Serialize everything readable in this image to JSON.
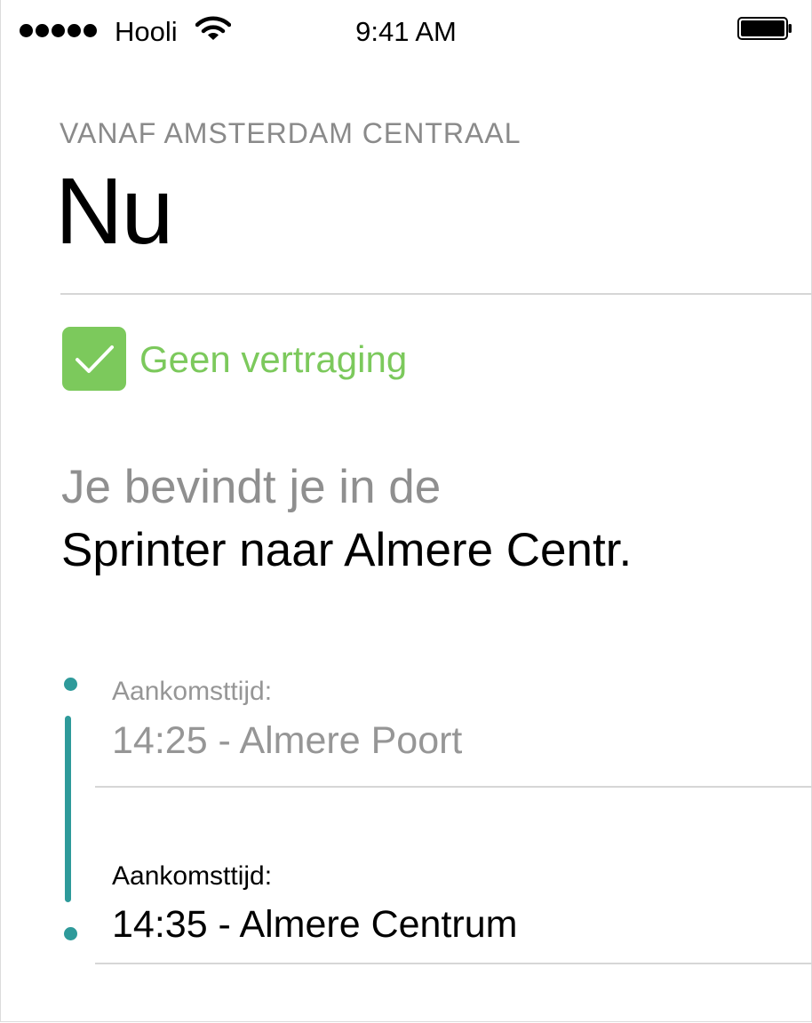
{
  "status_bar": {
    "carrier": "Hooli",
    "time": "9:41 AM",
    "signal_bars": 5,
    "battery_level": 1.0
  },
  "header": {
    "subtitle": "VANAF AMSTERDAM CENTRAAL",
    "title": "Nu"
  },
  "delay_status": {
    "label": "Geen vertraging",
    "icon": "checkmark-icon",
    "color": "#7cc95c"
  },
  "location": {
    "lead": "Je bevindt je in de",
    "train": "Sprinter naar Almere Centr."
  },
  "timeline": {
    "accent_color": "#2e9a9a",
    "stops": [
      {
        "label": "Aankomsttijd:",
        "value": "14:25 - Almere Poort",
        "state": "past"
      },
      {
        "label": "Aankomsttijd:",
        "value": "14:35 - Almere Centrum",
        "state": "upcoming"
      }
    ]
  }
}
